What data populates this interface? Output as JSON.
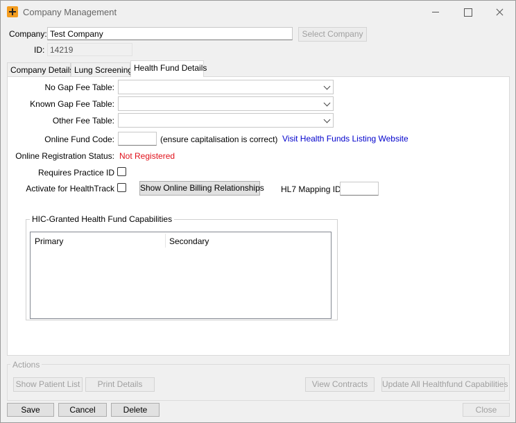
{
  "window": {
    "title": "Company Management"
  },
  "company": {
    "label": "Company:",
    "value": "Test Company",
    "select_button": "Select Company",
    "id_label": "ID:",
    "id_value": "14219"
  },
  "tabs": [
    {
      "label": "Company Details",
      "active": false
    },
    {
      "label": "Lung Screening",
      "active": false
    },
    {
      "label": "Health Fund Details",
      "active": true
    }
  ],
  "health_fund": {
    "no_gap_label": "No Gap Fee Table:",
    "no_gap_value": "",
    "known_gap_label": "Known Gap Fee Table:",
    "known_gap_value": "",
    "other_fee_label": "Other Fee Table:",
    "other_fee_value": "",
    "online_fund_code_label": "Online Fund Code:",
    "online_fund_code_value": "",
    "capitalisation_note": "(ensure capitalisation is correct)",
    "visit_link": "Visit Health Funds Listing Website",
    "registration_label": "Online Registration Status:",
    "registration_status": "Not Registered",
    "requires_practice_id_label": "Requires Practice ID",
    "requires_practice_id_checked": false,
    "activate_healthtrack_label": "Activate for HealthTrack",
    "activate_healthtrack_checked": false,
    "show_billing_button": "Show Online Billing Relationships",
    "hl7_label": "HL7 Mapping ID:",
    "hl7_value": ""
  },
  "capabilities": {
    "group_title": "HIC-Granted Health Fund Capabilities",
    "columns": [
      "Primary",
      "Secondary"
    ],
    "rows": []
  },
  "actions": {
    "group_title": "Actions",
    "show_patient_list": "Show Patient List",
    "print_details": "Print Details",
    "view_contracts": "View Contracts",
    "update_all": "Update All Healthfund Capabilities"
  },
  "footer": {
    "save": "Save",
    "cancel": "Cancel",
    "delete": "Delete",
    "close": "Close"
  },
  "colors": {
    "status_red": "#e0101a",
    "link_blue": "#0000cc",
    "app_icon": "#f39c1f"
  }
}
